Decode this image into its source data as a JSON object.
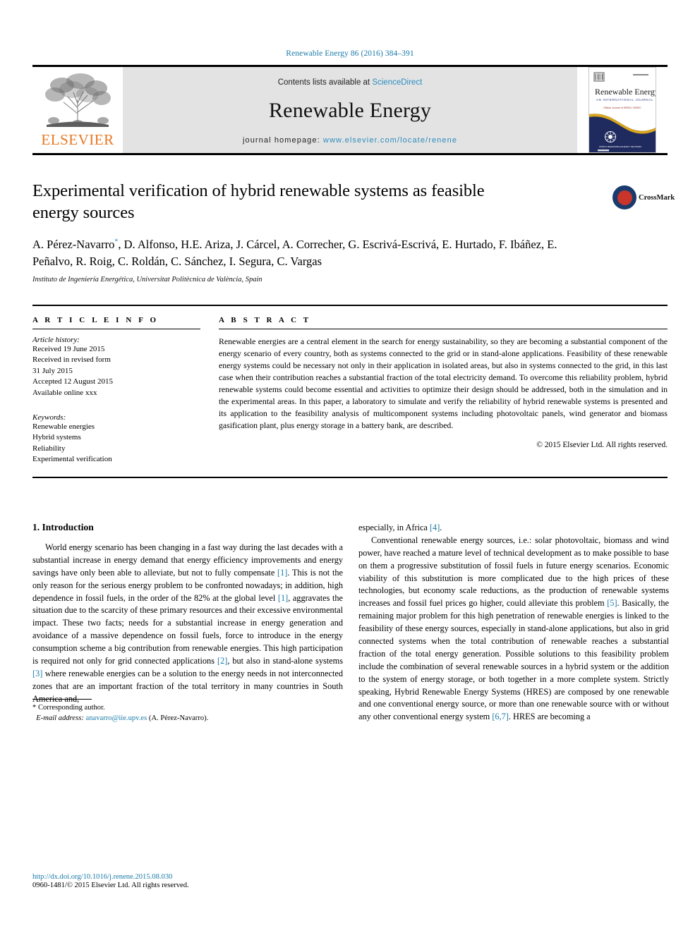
{
  "running_head": "Renewable Energy 86 (2016) 384–391",
  "masthead": {
    "publisher_logo_text": "ELSEVIER",
    "contents_prefix": "Contents lists available at ",
    "contents_link": "ScienceDirect",
    "journal_name": "Renewable Energy",
    "homepage_prefix": "journal homepage: ",
    "homepage_url": "www.elsevier.com/locate/renene",
    "cover": {
      "title": "Renewable Energy",
      "subtitle": "AN INTERNATIONAL JOURNAL",
      "tagline": "Official Journal of WREN / WREC"
    }
  },
  "article": {
    "title": "Experimental verification of hybrid renewable systems as feasible energy sources",
    "authors": "A. Pérez-Navarro, D. Alfonso, H.E. Ariza, J. Cárcel, A. Correcher, G. Escrivá-Escrivá, E. Hurtado, F. Ibáñez, E. Peñalvo, R. Roig, C. Roldán, C. Sánchez, I. Segura, C. Vargas",
    "corresponding_marker": "*",
    "affiliation": "Instituto de Ingeniería Energética, Universitat Politècnica de València, Spain",
    "crossmark_label": "CrossMark"
  },
  "info": {
    "heading": "A R T I C L E   I N F O",
    "history_label": "Article history:",
    "history": [
      "Received 19 June 2015",
      "Received in revised form",
      "31 July 2015",
      "Accepted 12 August 2015",
      "Available online xxx"
    ],
    "keywords_label": "Keywords:",
    "keywords": [
      "Renewable energies",
      "Hybrid systems",
      "Reliability",
      "Experimental verification"
    ]
  },
  "abstract": {
    "heading": "A B S T R A C T",
    "text": "Renewable energies are a central element in the search for energy sustainability, so they are becoming a substantial component of the energy scenario of every country, both as systems connected to the grid or in stand-alone applications. Feasibility of these renewable energy systems could be necessary not only in their application in isolated areas, but also in systems connected to the grid, in this last case when their contribution reaches a substantial fraction of the total electricity demand. To overcome this reliability problem, hybrid renewable systems could become essential and activities to optimize their design should be addressed, both in the simulation and in the experimental areas. In this paper, a laboratory to simulate and verify the reliability of hybrid renewable systems is presented and its application to the feasibility analysis of multicomponent systems including photovoltaic panels, wind generator and biomass gasification plant, plus energy storage in a battery bank, are described.",
    "copyright": "© 2015 Elsevier Ltd. All rights reserved."
  },
  "body": {
    "section_number_title": "1.  Introduction",
    "left_para1_a": "World energy scenario has been changing in a fast way during the last decades with a substantial increase in energy demand that energy efficiency improvements and energy savings have only been able to alleviate, but not to fully compensate ",
    "left_para1_ref1": "[1]",
    "left_para1_b": ". This is not the only reason for the serious energy problem to be confronted nowadays; in addition, high dependence in fossil fuels, in the order of the 82% at the global level ",
    "left_para1_ref2": "[1]",
    "left_para1_c": ", aggravates the situation due to the scarcity of these primary resources and their excessive environmental impact. These two facts; needs for a substantial increase in energy generation and avoidance of a massive dependence on fossil fuels, force to introduce in the energy consumption scheme a big contribution from renewable energies. This high participation is required not only for grid connected applications ",
    "left_para1_ref3": "[2]",
    "left_para1_d": ", but also in stand-alone systems ",
    "left_para1_ref4": "[3]",
    "left_para1_e": " where renewable energies can be a solution to the energy needs in not interconnected zones that are an important fraction of the total territory in many countries in South America and,",
    "right_para1_a": "especially, in Africa ",
    "right_para1_ref": "[4]",
    "right_para1_b": ".",
    "right_para2_a": "Conventional renewable energy sources, i.e.: solar photovoltaic, biomass and wind power, have reached a mature level of technical development as to make possible to base on them a progressive substitution of fossil fuels in future energy scenarios. Economic viability of this substitution is more complicated due to the high prices of these technologies, but economy scale reductions, as the production of renewable systems increases and fossil fuel prices go higher, could alleviate this problem ",
    "right_para2_ref1": "[5]",
    "right_para2_b": ". Basically, the remaining major problem for this high penetration of renewable energies is linked to the feasibility of these energy sources, especially in stand-alone applications, but also in grid connected systems when the total contribution of renewable reaches a substantial fraction of the total energy generation. Possible solutions to this feasibility problem include the combination of several renewable sources in a hybrid system or the addition to the system of energy storage, or both together in a more complete system. Strictly speaking, Hybrid Renewable Energy Systems (HRES) are composed by one renewable and one conventional energy source, or more than one renewable source with or without any other conventional energy system ",
    "right_para2_ref2": "[6,7]",
    "right_para2_c": ". HRES are becoming a"
  },
  "footnote": {
    "corresponding": "* Corresponding author.",
    "email_label": "E-mail address: ",
    "email": "anavarro@iie.upv.es",
    "email_suffix": " (A. Pérez-Navarro)."
  },
  "footer": {
    "doi": "http://dx.doi.org/10.1016/j.renene.2015.08.030",
    "issn_line": "0960-1481/© 2015 Elsevier Ltd. All rights reserved."
  },
  "colors": {
    "link_blue": "#1a7aa8",
    "sciencedirect_blue": "#2b8cbe",
    "elsevier_orange": "#E87722",
    "cover_navy": "#1f2a5e",
    "crossmark_red": "#c9342b"
  }
}
